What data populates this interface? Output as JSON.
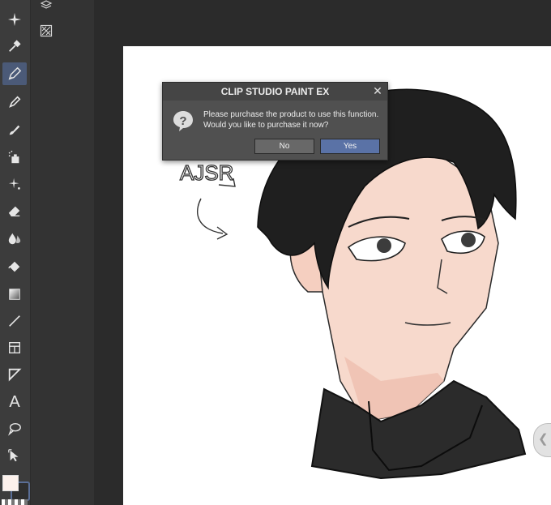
{
  "dialog": {
    "title": "CLIP STUDIO PAINT EX",
    "message_line1": "Please purchase the product to use this function.",
    "message_line2": "Would you like to purchase it now?",
    "no_label": "No",
    "yes_label": "Yes",
    "icon": "question-icon",
    "close_icon": "close-icon"
  },
  "toolbar": {
    "tools": [
      "sparkle-icon",
      "eyedropper-icon",
      "pen-icon",
      "pencil-icon",
      "brush-icon",
      "airbrush-icon",
      "decoration-icon",
      "eraser-icon",
      "blend-icon",
      "fill-icon",
      "gradient-icon",
      "line-icon",
      "frame-icon",
      "ruler-icon",
      "text-icon",
      "balloon-icon",
      "select-arrow-icon"
    ],
    "active_tool": "pen-icon",
    "text_tool_glyph": "A"
  },
  "subtools": [
    "layers-icon",
    "crosshatch-icon"
  ],
  "colors": {
    "main_color": "#fdf1ec",
    "sub_color": "#2f2f2f",
    "accent": "#5a72a6",
    "dialog_bg": "#505050"
  },
  "canvas": {
    "sketch_text": "AJSR"
  }
}
